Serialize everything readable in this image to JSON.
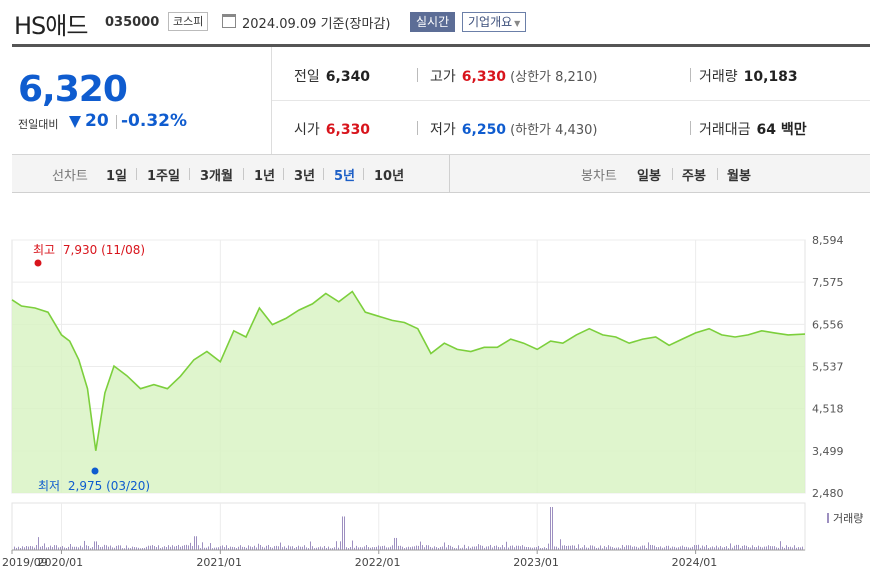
{
  "header": {
    "stock_name": "HS애드",
    "stock_code": "035000",
    "market": "코스피",
    "date_text": "2024.09.09 기준(장마감)",
    "realtime_label": "실시간",
    "overview_label": "기업개요"
  },
  "price": {
    "current": "6,320",
    "change_label": "전일대비",
    "change_value": "20",
    "change_percent": "-0.32%"
  },
  "stats": {
    "prev_close": {
      "label": "전일",
      "value": "6,340"
    },
    "high": {
      "label": "고가",
      "value": "6,330",
      "limit": "(상한가 8,210)"
    },
    "volume": {
      "label": "거래량",
      "value": "10,183"
    },
    "open": {
      "label": "시가",
      "value": "6,330"
    },
    "low": {
      "label": "저가",
      "value": "6,250",
      "limit": "(하한가 4,430)"
    },
    "trade_amount": {
      "label": "거래대금",
      "value": "64 백만"
    }
  },
  "periods": {
    "line_chart_label": "선차트",
    "items": [
      "1일",
      "1주일",
      "3개월",
      "1년",
      "3년",
      "5년",
      "10년"
    ],
    "selected": "5년",
    "candle_chart_label": "봉차트",
    "candle_items": [
      "일봉",
      "주봉",
      "월봉"
    ]
  },
  "colors": {
    "up": "#d8141c",
    "down": "#0f5ccf",
    "line": "#7ccf3c",
    "fill": "#d9f3c4",
    "volume_bar": "#9d8fc0"
  },
  "chart_data": {
    "type": "area",
    "y_ticks": [
      "8,594",
      "7,575",
      "6,556",
      "5,537",
      "4,518",
      "3,499",
      "2,480"
    ],
    "ylim": [
      2480,
      8594
    ],
    "x_ticks": [
      "2019/09",
      "2020/01",
      "2021/01",
      "2022/01",
      "2023/01",
      "2024/01"
    ],
    "x_start": "2019-09-09",
    "x_end": "2024-09-09",
    "high_label": "최고",
    "high_value": "7,930 (11/08)",
    "low_label": "최저",
    "low_value": "2,975 (03/20)",
    "volume_legend": "거래량",
    "series": [
      {
        "dates": [
          "2019-09-09",
          "2019-10-01",
          "2019-11-01",
          "2019-12-01",
          "2020-01-01",
          "2020-01-20",
          "2020-02-10",
          "2020-03-01",
          "2020-03-20",
          "2020-04-10",
          "2020-05-01",
          "2020-06-01",
          "2020-07-01",
          "2020-08-01",
          "2020-09-01",
          "2020-10-01",
          "2020-11-01",
          "2020-12-01",
          "2021-01-01",
          "2021-02-01",
          "2021-03-01",
          "2021-04-01",
          "2021-05-01",
          "2021-06-01",
          "2021-07-01",
          "2021-08-01",
          "2021-09-01",
          "2021-10-01",
          "2021-11-01",
          "2021-12-01",
          "2022-01-01",
          "2022-02-01",
          "2022-03-01",
          "2022-04-01",
          "2022-05-01",
          "2022-06-01",
          "2022-07-01",
          "2022-08-01",
          "2022-09-01",
          "2022-10-01",
          "2022-11-01",
          "2022-12-01",
          "2023-01-01",
          "2023-02-01",
          "2023-03-01",
          "2023-04-01",
          "2023-05-01",
          "2023-06-01",
          "2023-07-01",
          "2023-08-01",
          "2023-09-01",
          "2023-10-01",
          "2023-11-01",
          "2023-12-01",
          "2024-01-01",
          "2024-02-01",
          "2024-03-01",
          "2024-04-01",
          "2024-05-01",
          "2024-06-01",
          "2024-07-01",
          "2024-08-01",
          "2024-09-09"
        ],
        "values": [
          7150,
          7000,
          6950,
          6850,
          6300,
          6150,
          5700,
          5000,
          3500,
          4900,
          5550,
          5300,
          5000,
          5100,
          5000,
          5300,
          5700,
          5900,
          5650,
          6400,
          6250,
          6950,
          6550,
          6700,
          6900,
          7050,
          7300,
          7100,
          7350,
          6850,
          6750,
          6650,
          6600,
          6450,
          5850,
          6100,
          5950,
          5900,
          6000,
          6000,
          6200,
          6100,
          5950,
          6150,
          6100,
          6300,
          6450,
          6300,
          6250,
          6100,
          6200,
          6250,
          6050,
          6200,
          6350,
          6450,
          6300,
          6250,
          6300,
          6400,
          6350,
          6300,
          6320
        ]
      }
    ]
  }
}
